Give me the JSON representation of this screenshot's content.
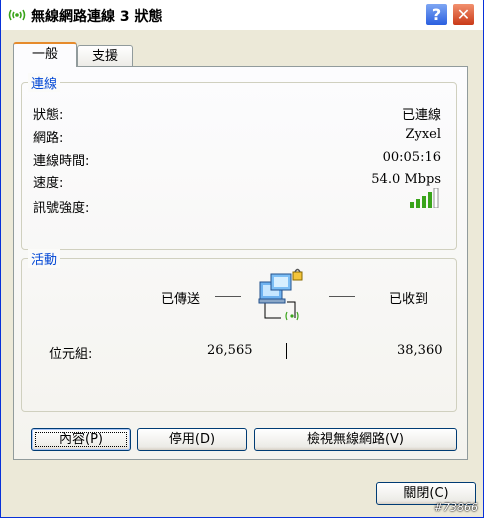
{
  "window": {
    "title": "無線網路連線 3 狀態",
    "help_symbol": "?",
    "close_symbol": "✕"
  },
  "tabs": [
    {
      "label": "一般",
      "selected": true
    },
    {
      "label": "支援",
      "selected": false
    }
  ],
  "connection": {
    "group_title": "連線",
    "rows": [
      {
        "label": "狀態:",
        "value": "已連線"
      },
      {
        "label": "網路:",
        "value": "Zyxel"
      },
      {
        "label": "連線時間:",
        "value": "00:05:16"
      },
      {
        "label": "速度:",
        "value": "54.0 Mbps"
      },
      {
        "label": "訊號強度:",
        "value": ""
      }
    ],
    "signal_bars": 5,
    "signal_bars_filled": 4
  },
  "activity": {
    "group_title": "活動",
    "sent_label": "已傳送",
    "received_label": "已收到",
    "bytes_label": "位元組:",
    "bytes_sent": "26,565",
    "bytes_received": "38,360"
  },
  "buttons": {
    "properties": "內容(P)",
    "disable": "停用(D)",
    "view_networks": "檢視無線網路(V)",
    "close": "關閉(C)"
  },
  "watermark": "#73866",
  "colors": {
    "group_title": "#0046d5",
    "signal_green": "#3aa41b",
    "close_red": "#c93a18"
  }
}
